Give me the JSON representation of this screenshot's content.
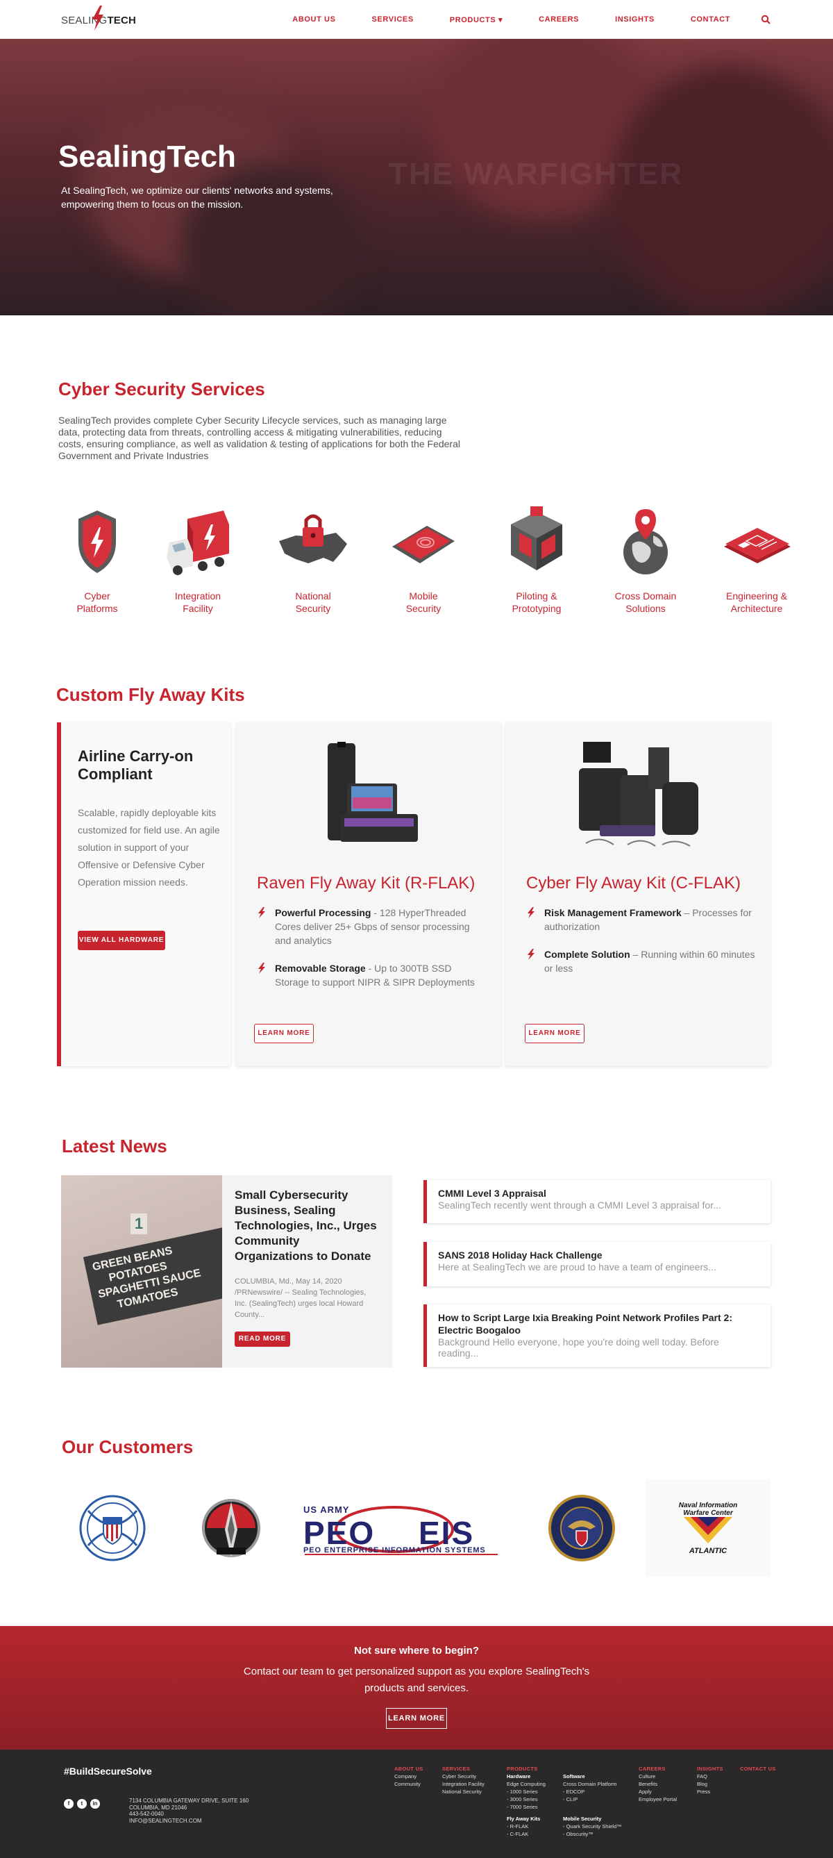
{
  "brand": {
    "logo_prefix": "SEALING",
    "logo_suffix": "TECH",
    "accent_color": "#c8242e"
  },
  "nav": {
    "items": [
      "ABOUT US",
      "SERVICES",
      "PRODUCTS",
      "CAREERS",
      "INSIGHTS",
      "CONTACT"
    ],
    "products_caret": "▾",
    "search_icon": "search-icon"
  },
  "hero": {
    "title": "SealingTech",
    "subtitle": "At SealingTech, we optimize our clients' networks and systems, empowering them to focus on the mission.",
    "watermark": "THE WARFIGHTER"
  },
  "cyber": {
    "title": "Cyber Security Services",
    "description": "SealingTech provides complete Cyber Security Lifecycle services, such as managing large data, protecting data from threats, controlling access & mitigating vulnerabilities, reducing costs, ensuring compliance, as well as validation & testing of applications for both the Federal Government and Private Industries",
    "services": [
      {
        "line1": "Cyber",
        "line2": "Platforms",
        "icon": "shield-icon"
      },
      {
        "line1": "Integration",
        "line2": "Facility",
        "icon": "truck-icon"
      },
      {
        "line1": "National",
        "line2": "Security",
        "icon": "us-map-lock-icon"
      },
      {
        "line1": "Mobile",
        "line2": "Security",
        "icon": "phone-fingerprint-icon"
      },
      {
        "line1": "Piloting &",
        "line2": "Prototyping",
        "icon": "cube-icon"
      },
      {
        "line1": "Cross Domain",
        "line2": "Solutions",
        "icon": "globe-pin-icon"
      },
      {
        "line1": "Engineering &",
        "line2": "Architecture",
        "icon": "blueprint-icon"
      }
    ]
  },
  "kits": {
    "title": "Custom Fly Away Kits",
    "intro": {
      "heading": "Airline Carry-on Compliant",
      "body": "Scalable, rapidly deployable kits customized for field use. An agile solution in support of your Offensive or Defensive Cyber Operation mission needs.",
      "button": "VIEW ALL HARDWARE"
    },
    "rflak": {
      "title": "Raven Fly Away Kit (R-FLAK)",
      "f1_bold": "Powerful Processing",
      "f1_text": " - 128 HyperThreaded Cores deliver 25+ Gbps of sensor processing and analytics",
      "f2_bold": "Removable Storage",
      "f2_text": " - Up to 300TB SSD Storage to support NIPR & SIPR Deployments",
      "button": "LEARN MORE"
    },
    "cflak": {
      "title": "Cyber Fly Away Kit (C-FLAK)",
      "f1_bold": "Risk Management Framework",
      "f1_text": " – Processes for authorization",
      "f2_bold": "Complete Solution",
      "f2_text": " – Running within 60 minutes or less",
      "button": "LEARN MORE"
    }
  },
  "news": {
    "title": "Latest News",
    "featured": {
      "title": "Small Cybersecurity Business, Sealing Technologies, Inc., Urges Community Organizations to Donate",
      "excerpt": "COLUMBIA, Md., May 14, 2020 /PRNewswire/ -- Sealing Technologies, Inc. (SealingTech) urges local Howard County...",
      "button": "READ MORE",
      "sign_number": "1",
      "sign_lines": [
        "GREEN BEANS",
        "POTATOES",
        "SPAGHETTI SAUCE",
        "TOMATOES"
      ]
    },
    "items": [
      {
        "title": "CMMI Level 3 Appraisal",
        "desc": "SealingTech recently went through a CMMI Level 3 appraisal for..."
      },
      {
        "title": "SANS 2018 Holiday Hack Challenge",
        "desc": "Here at SealingTech we are proud to have a team of engineers..."
      },
      {
        "title": "How to Script Large Ixia Breaking Point Network Profiles Part 2: Electric Boogaloo",
        "desc": "Background Hello everyone, hope you're doing well today. Before reading..."
      }
    ]
  },
  "customers": {
    "title": "Our Customers",
    "peo_top": "US ARMY",
    "peo_big1": "PEO",
    "peo_big2": "EIS",
    "peo_sub": "PEO ENTERPRISE INFORMATION SYSTEMS",
    "niwc_line1": "Naval Information",
    "niwc_line2": "Warfare Center",
    "niwc_line3": "ATLANTIC"
  },
  "cta": {
    "question": "Not sure where to begin?",
    "text": "Contact our team to get personalized support as you explore SealingTech's products and services.",
    "button": "LEARN MORE"
  },
  "footer": {
    "hashtag": "#BuildSecureSolve",
    "address": [
      "7134 COLUMBIA GATEWAY DRIVE, SUITE 160",
      "COLUMBIA, MD 21046",
      "443-542-0040",
      "INFO@SEALINGTECH.COM"
    ],
    "social": [
      "f",
      "t",
      "in"
    ],
    "about": {
      "h": "ABOUT US",
      "items": [
        "Company",
        "Community"
      ]
    },
    "services": {
      "h": "SERVICES",
      "items": [
        "Cyber Security",
        "Integration Facility",
        "National Security"
      ]
    },
    "products": {
      "h": "PRODUCTS",
      "hardware": "Hardware",
      "hw_items": [
        "Edge Computing",
        "- 1000 Series",
        "- 3000 Series",
        "- 7000 Series"
      ],
      "kits": "Fly Away Kits",
      "kit_items": [
        "- R-FLAK",
        "- C-FLAK"
      ]
    },
    "software": {
      "h": "Software",
      "items": [
        "Cross Domain Platform",
        "- EDCOP",
        "- CLIP"
      ],
      "mobile": "Mobile Security",
      "mobile_items": [
        "- Quark Security Shield™",
        "- Obscurity™"
      ]
    },
    "careers": {
      "h": "CAREERS",
      "items": [
        "Culture",
        "Benefits",
        "Apply",
        "Employee Portal"
      ]
    },
    "insights": {
      "h": "INSIGHTS",
      "items": [
        "FAQ",
        "Blog",
        "Press"
      ]
    },
    "contact": {
      "h": "CONTACT US"
    }
  }
}
